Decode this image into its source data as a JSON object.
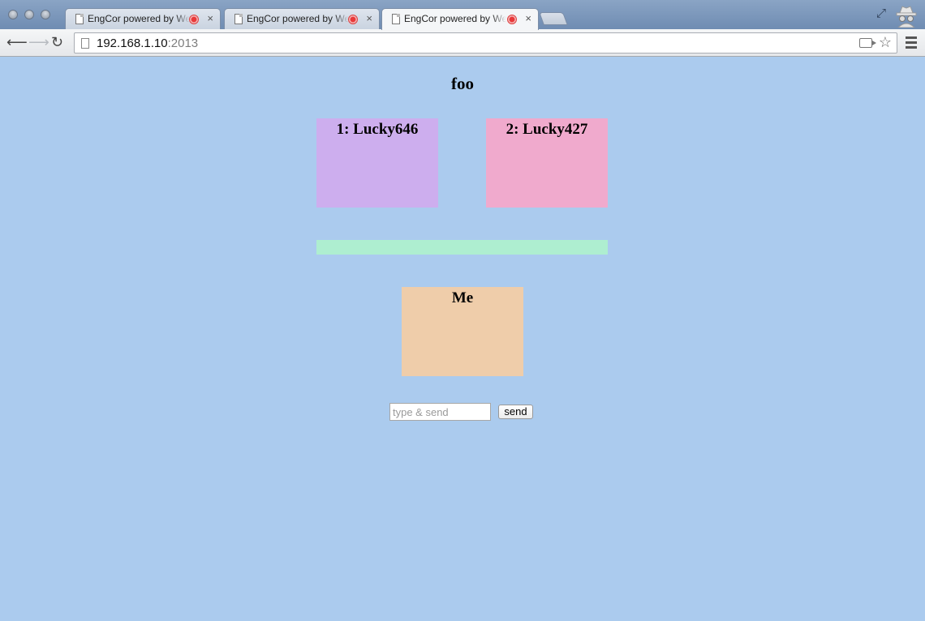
{
  "browser": {
    "tabs": [
      {
        "title": "EngCor powered by WebRTC",
        "active": false
      },
      {
        "title": "EngCor powered by WebRTC",
        "active": false
      },
      {
        "title": "EngCor powered by WebRTC",
        "active": true
      }
    ],
    "tab_close_glyph": "×",
    "address": {
      "host": "192.168.1.10",
      "port": ":2013"
    },
    "icons": [
      "back-icon",
      "forward-icon",
      "reload-icon",
      "page-icon",
      "camera-icon",
      "star-icon",
      "menu-icon",
      "expand-icon",
      "incognito-icon"
    ]
  },
  "page": {
    "title": "foo",
    "peers": [
      {
        "label": "1: Lucky646",
        "color": "#cdaeee"
      },
      {
        "label": "2: Lucky427",
        "color": "#f0aacd"
      }
    ],
    "status_bar_color": "#aeeed0",
    "self": {
      "label": "Me",
      "color": "#efcdaa"
    },
    "input": {
      "placeholder": "type & send",
      "value": ""
    },
    "send_label": "send"
  }
}
